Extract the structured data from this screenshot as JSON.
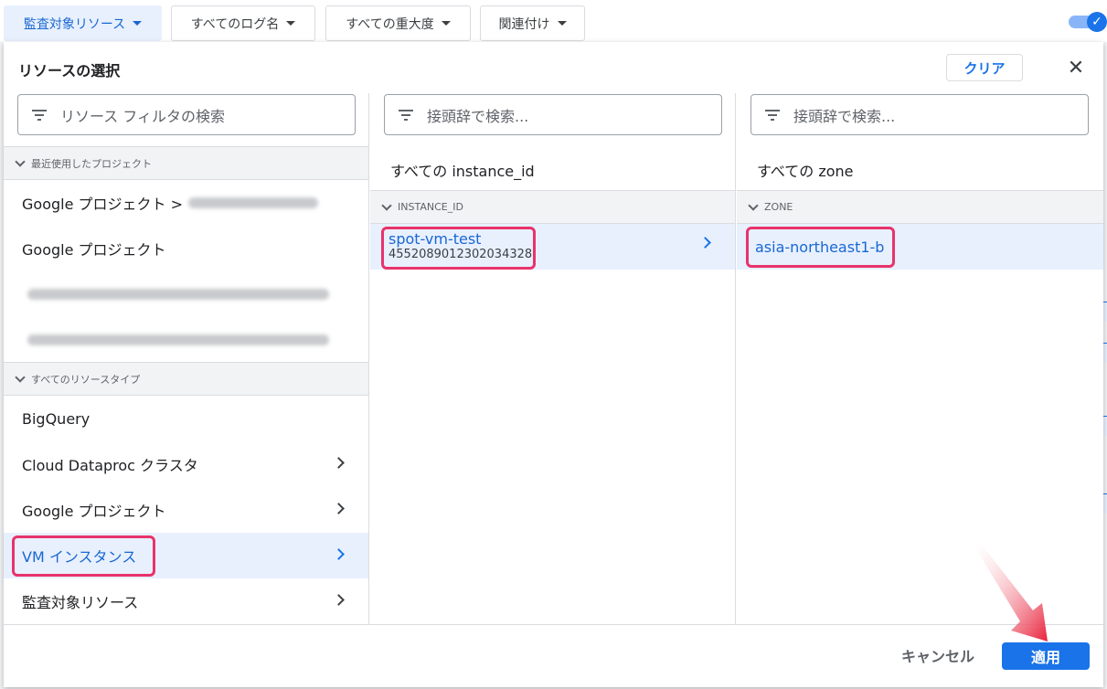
{
  "filters": {
    "resource": "監査対象リソース",
    "log_name": "すべてのログ名",
    "severity": "すべての重大度",
    "correlation": "関連付け"
  },
  "dialog": {
    "title": "リソースの選択",
    "clear_label": "クリア",
    "close_icon": "close-icon",
    "cancel_label": "キャンセル",
    "apply_label": "適用"
  },
  "col1": {
    "search_placeholder": "リソース フィルタの検索",
    "recent_header": "最近使用したプロジェクト",
    "recent_items": [
      {
        "label": "Google プロジェクト >"
      },
      {
        "label": "Google プロジェクト"
      }
    ],
    "types_header": "すべてのリソースタイプ",
    "types": [
      {
        "label": "BigQuery"
      },
      {
        "label": "Cloud Dataproc クラスタ"
      },
      {
        "label": "Google プロジェクト"
      },
      {
        "label": "VM インスタンス"
      },
      {
        "label": "監査対象リソース"
      }
    ]
  },
  "col2": {
    "search_placeholder": "接頭辞で検索...",
    "label": "すべての instance_id",
    "header": "INSTANCE_ID",
    "item_name": "spot-vm-test",
    "item_id": "4552089012302034328"
  },
  "col3": {
    "search_placeholder": "接頭辞で検索...",
    "label": "すべての zone",
    "header": "ZONE",
    "item": "asia-northeast1-b"
  },
  "colors": {
    "accent": "#1a73e8",
    "selected_bg": "#e8f0fe",
    "highlight": "#e8336b",
    "arrow": "#e8213a"
  }
}
